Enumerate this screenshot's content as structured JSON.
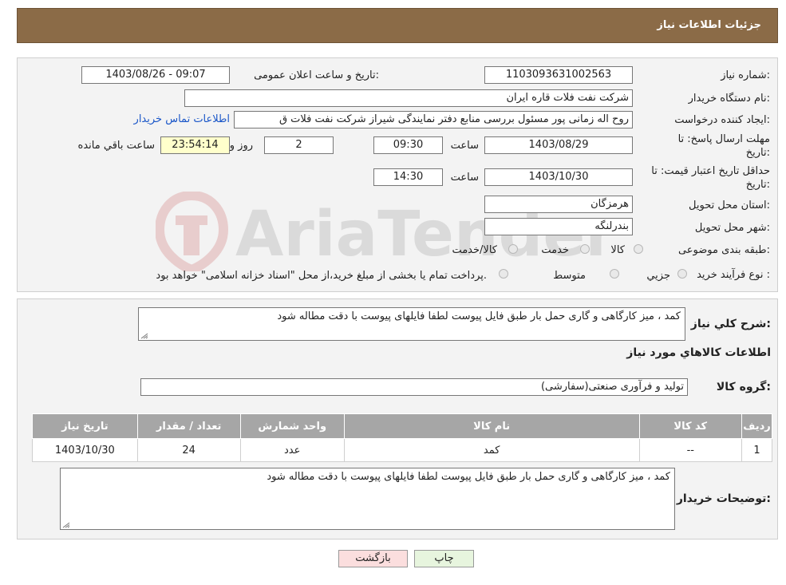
{
  "header": {
    "title": "جزئیات اطلاعات نیاز"
  },
  "form": {
    "need_number_label": "شماره نیاز:",
    "need_number": "1103093631002563",
    "announce_label": "تاریخ و ساعت اعلان عمومی:",
    "announce_value": "1403/08/26 - 09:07",
    "buyer_org_label": "نام دستگاه خریدار:",
    "buyer_org": "شرکت نفت فلات قاره ایران",
    "creator_label": "ایجاد کننده درخواست:",
    "creator": "روح اله زمانی پور مسئول بررسی منابع دفتر نمایندگی شیراز شرکت نفت فلات ق",
    "contact_link": "اطلاعات تماس خریدار",
    "deadline_label_1": "مهلت ارسال پاسخ: تا",
    "deadline_label_2": "تاریخ:",
    "deadline_date": "1403/08/29",
    "time_label": "ساعت",
    "deadline_time": "09:30",
    "days_value": "2",
    "days_label": "روز و",
    "remaining_time": "23:54:14",
    "remaining_label": "ساعت باقي مانده",
    "validity_label_1": "حداقل تاريخ اعتبار قيمت: تا",
    "validity_label_2": "تاريخ:",
    "validity_date": "1403/10/30",
    "validity_time": "14:30",
    "province_label": "استان محل تحویل:",
    "province": "هرمزگان",
    "city_label": "شهر محل تحویل:",
    "city": "بندرلنگه",
    "category_label": "طبقه بندی موضوعی:",
    "category_options": [
      "کالا",
      "خدمت",
      "کالا/خدمت"
    ],
    "process_label": "نوع فرآیند خرید :",
    "process_options": [
      "جزیي",
      "متوسط"
    ],
    "process_note": "پرداخت تمام یا بخشی از مبلغ خرید،از محل \"اسناد خزانه اسلامی\" خواهد بود."
  },
  "summary": {
    "label": "شرح کلي نياز:",
    "text": "کمد ، میز کارگاهی و گاری حمل بار طبق فایل پیوست لطفا فایلهای پیوست با دقت مطاله شود",
    "goods_info_title": "اطلاعات کالاهاي مورد نياز",
    "group_label": "گروه کالا:",
    "group_value": "تولید و فرآوری صنعتی(سفارشی)"
  },
  "table": {
    "headers": [
      "ردیف",
      "کد کالا",
      "نام کالا",
      "واحد شمارش",
      "تعداد / مقدار",
      "تاریخ نیاز"
    ],
    "rows": [
      [
        "1",
        "--",
        "کمد",
        "عدد",
        "24",
        "1403/10/30"
      ]
    ]
  },
  "buyer_notes": {
    "label": "توضیحات خریدار:",
    "text": "کمد ، میز کارگاهی و گاری حمل بار طبق فایل پیوست لطفا فایلهای پیوست با دقت مطاله شود"
  },
  "buttons": {
    "print": "چاپ",
    "back": "بازگشت"
  },
  "watermark": {
    "text": "AriaTender.neT"
  },
  "colors": {
    "header_bg": "#8b6b47",
    "table_header_bg": "#a6a6a6",
    "back_button_bg": "#fbdede",
    "print_button_bg": "#e7f5de"
  }
}
